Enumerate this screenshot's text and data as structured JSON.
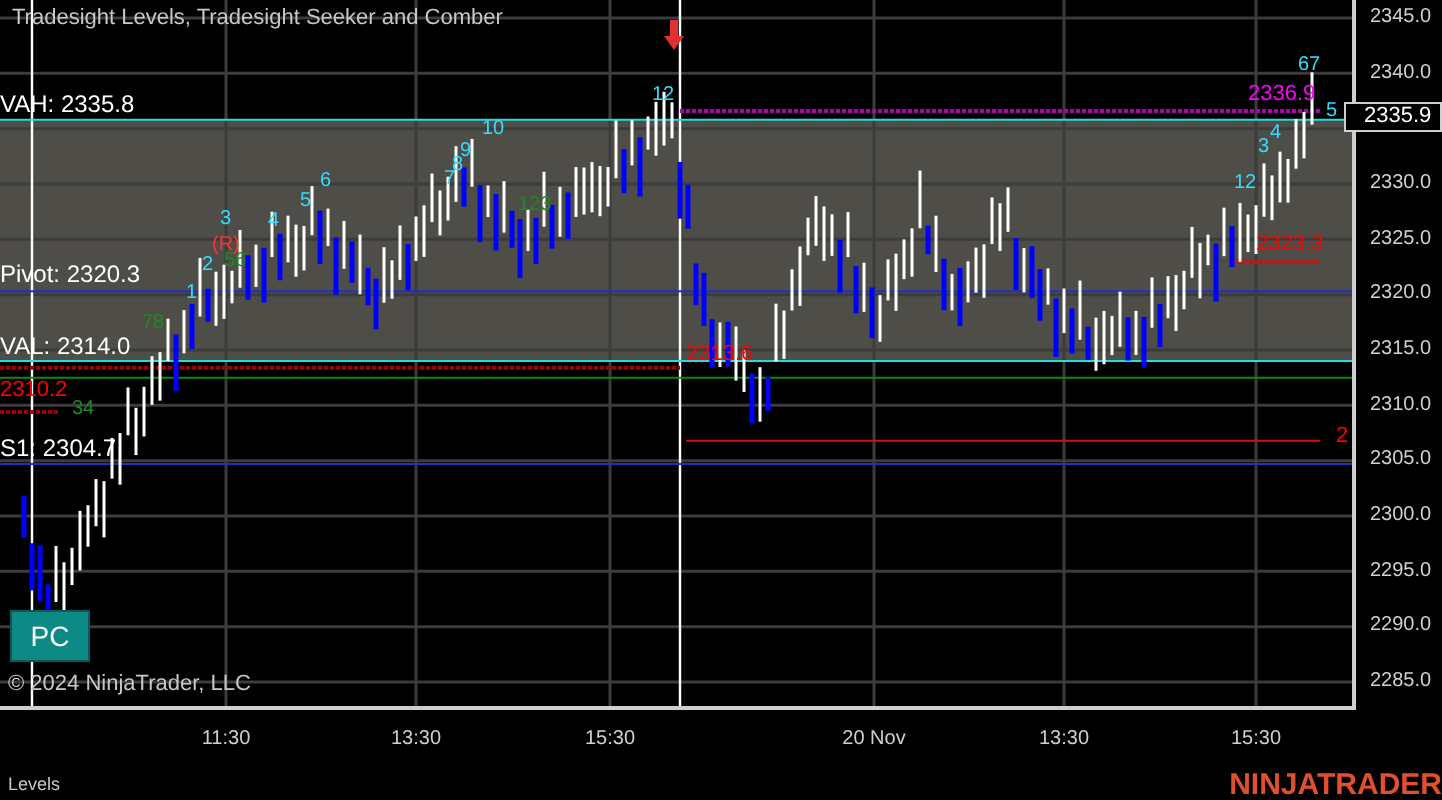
{
  "chart": {
    "title": "Tradesight Levels, Tradesight Seeker and Comber",
    "levels": [
      {
        "label": "VAH: 2335.8"
      },
      {
        "label": "Pivot: 2320.3"
      },
      {
        "label": "VAL: 2314.0"
      },
      {
        "label": "S1: 2304.7"
      }
    ],
    "price_labels": [
      {
        "text": "2310.2",
        "color": "#ff0000"
      },
      {
        "text": "2313.6",
        "color": "#ff0000"
      },
      {
        "text": "2323.3",
        "color": "#ff0000"
      },
      {
        "text": "2336.9",
        "color": "#ff00ff"
      },
      {
        "text": "2",
        "color": "#ff0000"
      }
    ],
    "count_labels": [
      {
        "text": "1",
        "color": "#33ddff"
      },
      {
        "text": "2",
        "color": "#33ddff"
      },
      {
        "text": "3",
        "color": "#33ddff"
      },
      {
        "text": "(R)",
        "color": "#ff3333"
      },
      {
        "text": "4",
        "color": "#33ddff"
      },
      {
        "text": "5",
        "color": "#33ddff"
      },
      {
        "text": "6",
        "color": "#33ddff"
      },
      {
        "text": "7",
        "color": "#33ddff"
      },
      {
        "text": "8",
        "color": "#33ddff"
      },
      {
        "text": "9",
        "color": "#33ddff"
      },
      {
        "text": "10",
        "color": "#33ddff"
      },
      {
        "text": "12",
        "color": "#33ddff"
      },
      {
        "text": "12",
        "color": "#33ddff"
      },
      {
        "text": "3",
        "color": "#33ddff"
      },
      {
        "text": "4",
        "color": "#33ddff"
      },
      {
        "text": "5",
        "color": "#33ddff"
      },
      {
        "text": "67",
        "color": "#33ddff"
      },
      {
        "text": "56",
        "color": "#1f8a1f"
      },
      {
        "text": "78",
        "color": "#1f8a1f"
      },
      {
        "text": "34",
        "color": "#1f8a1f"
      },
      {
        "text": "123",
        "color": "#1f8a1f"
      }
    ],
    "pc_button": "PC",
    "copyright": "© 2024 NinjaTrader, LLC"
  },
  "price_axis": {
    "ticks": [
      "2345.0",
      "2340.0",
      "2330.0",
      "2325.0",
      "2320.0",
      "2315.0",
      "2310.0",
      "2305.0",
      "2300.0",
      "2295.0",
      "2290.0",
      "2285.0"
    ],
    "current_price": "2335.9"
  },
  "time_axis": {
    "labels": [
      "11:30",
      "13:30",
      "15:30",
      "20 Nov",
      "13:30",
      "15:30"
    ]
  },
  "footer": {
    "tab": "Levels",
    "logo": "NINJATRADER"
  }
}
